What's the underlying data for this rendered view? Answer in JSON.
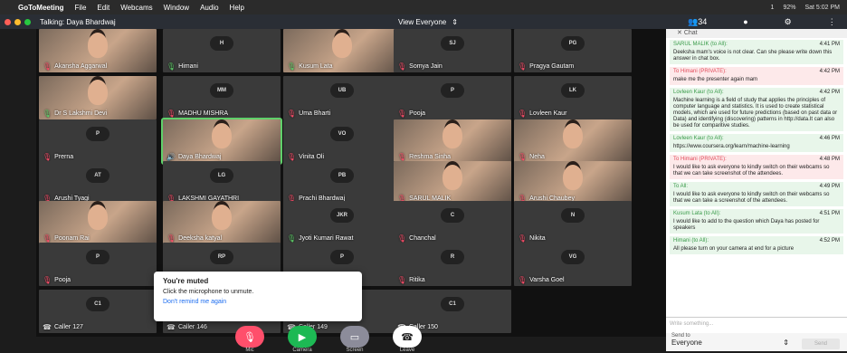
{
  "menubar": {
    "apple": "",
    "app": "GoToMeeting",
    "items": [
      "File",
      "Edit",
      "Webcams",
      "Window",
      "Audio",
      "Help"
    ],
    "status": [
      "1",
      "92%",
      "Sat 5:02 PM"
    ]
  },
  "titlebar": {
    "talking": "Talking: Daya Bhardwaj",
    "view": "View Everyone",
    "count": "34"
  },
  "tiles": [
    {
      "name": "Akansha Aggarwal",
      "initials": "",
      "mic": "muted",
      "photo": true
    },
    {
      "name": "Himani",
      "initials": "H",
      "mic": "on",
      "photo": false
    },
    {
      "name": "Kusum Lata",
      "initials": "",
      "mic": "on",
      "photo": true
    },
    {
      "name": "Somya Jain",
      "initials": "SJ",
      "mic": "muted",
      "photo": false
    },
    {
      "name": "Pragya Gautam",
      "initials": "PG",
      "mic": "muted",
      "photo": false
    },
    {
      "name": "Dr S Lakshmi Devi",
      "initials": "",
      "mic": "on",
      "photo": true
    },
    {
      "name": "MADHU MISHRA",
      "initials": "MM",
      "mic": "muted",
      "photo": false
    },
    {
      "name": "Uma Bharti",
      "initials": "UB",
      "mic": "muted",
      "photo": false
    },
    {
      "name": "Pooja",
      "initials": "P",
      "mic": "muted",
      "photo": false
    },
    {
      "name": "Lovleen Kaur",
      "initials": "LK",
      "mic": "muted",
      "photo": false
    },
    {
      "name": "Prerna",
      "initials": "P",
      "mic": "muted",
      "photo": false
    },
    {
      "name": "Daya Bhardwaj",
      "initials": "",
      "mic": "speak",
      "photo": true
    },
    {
      "name": "Vinita Oli",
      "initials": "VO",
      "mic": "muted",
      "photo": false
    },
    {
      "name": "Reshma Sinha",
      "initials": "",
      "mic": "muted",
      "photo": true
    },
    {
      "name": "Neha",
      "initials": "",
      "mic": "muted",
      "photo": true
    },
    {
      "name": "Arushi Tyagi",
      "initials": "AT",
      "mic": "muted",
      "photo": false
    },
    {
      "name": "LAKSHMI GAYATHRI",
      "initials": "LG",
      "mic": "muted",
      "photo": false
    },
    {
      "name": "Prachi Bhardwaj",
      "initials": "PB",
      "mic": "muted",
      "photo": false
    },
    {
      "name": "SARUL MALIK",
      "initials": "",
      "mic": "muted",
      "photo": true
    },
    {
      "name": "Arushi Chaubey",
      "initials": "",
      "mic": "muted",
      "photo": true
    },
    {
      "name": "Poonam Rai",
      "initials": "",
      "mic": "muted",
      "photo": true
    },
    {
      "name": "Deeksha katyal",
      "initials": "",
      "mic": "muted",
      "photo": true
    },
    {
      "name": "Jyoti Kumari Rawat",
      "initials": "JKR",
      "mic": "on",
      "photo": false
    },
    {
      "name": "Chanchal",
      "initials": "C",
      "mic": "muted",
      "photo": false
    },
    {
      "name": "Nikita",
      "initials": "N",
      "mic": "muted",
      "photo": false
    },
    {
      "name": "Pooja",
      "initials": "P",
      "mic": "muted",
      "photo": false
    },
    {
      "name": "",
      "initials": "RP",
      "mic": "",
      "photo": false
    },
    {
      "name": "",
      "initials": "P",
      "mic": "",
      "photo": false
    },
    {
      "name": "Ritika",
      "initials": "R",
      "mic": "muted",
      "photo": false
    },
    {
      "name": "Varsha Goel",
      "initials": "VG",
      "mic": "muted",
      "photo": false
    },
    {
      "name": "Caller 127",
      "initials": "C1",
      "mic": "phone",
      "photo": false
    },
    {
      "name": "Caller 146",
      "initials": "",
      "mic": "phone",
      "photo": false
    },
    {
      "name": "Caller 149",
      "initials": "",
      "mic": "phone",
      "photo": false
    },
    {
      "name": "Caller 150",
      "initials": "C1",
      "mic": "phone",
      "photo": false
    }
  ],
  "popup": {
    "title": "You're muted",
    "body": "Click the microphone to unmute.",
    "link": "Don't remind me again"
  },
  "controls": [
    {
      "label": "Mic",
      "color": "#ff4f6b"
    },
    {
      "label": "Camera",
      "color": "#1db954"
    },
    {
      "label": "Screen",
      "color": "#8c8c9a"
    },
    {
      "label": "Leave",
      "color": "#ffffff"
    }
  ],
  "chat": {
    "header": "Chat",
    "messages": [
      {
        "from": "SARUL MALIK (to All):",
        "time": "4:41 PM",
        "type": "all",
        "text": "Deeksha mam's voice is not clear. Can she please write down this answer in chat box."
      },
      {
        "from": "To Himani (PRIVATE):",
        "time": "4:42 PM",
        "type": "priv",
        "text": "make me the presenter again mam"
      },
      {
        "from": "Lovleen Kaur (to All):",
        "time": "4:42 PM",
        "type": "all",
        "text": "Machine learning is a field of study that applies the principles of computer language and statistics. It is used to create statistical models, which are used for future predictions (based on past data or Data) and identifying (discovering) patterns in http://data.It can also be used for comparitive studies."
      },
      {
        "from": "Lovleen Kaur (to All):",
        "time": "4:46 PM",
        "type": "all",
        "text": "https://www.coursera.org/learn/machine-learning"
      },
      {
        "from": "To Himani (PRIVATE):",
        "time": "4:48 PM",
        "type": "priv",
        "text": "I would like to ask everyone to kindly switch on their webcams so that we can take screenshot of the attendees."
      },
      {
        "from": "To All:",
        "time": "4:49 PM",
        "type": "all",
        "text": "I would like to ask everyone to kindly switch on their webcams so that we can take a screenshot of the attendees."
      },
      {
        "from": "Kusum Lata (to All):",
        "time": "4:51 PM",
        "type": "all",
        "text": "I would like to add to the question which Daya has posted for speakers"
      },
      {
        "from": "Himani (to All):",
        "time": "4:52 PM",
        "type": "all",
        "text": "All please turn on your camera at end for a picture"
      }
    ],
    "input_placeholder": "Write something...",
    "send_to_label": "Send to",
    "send_to_value": "Everyone",
    "send_button": "Send"
  }
}
